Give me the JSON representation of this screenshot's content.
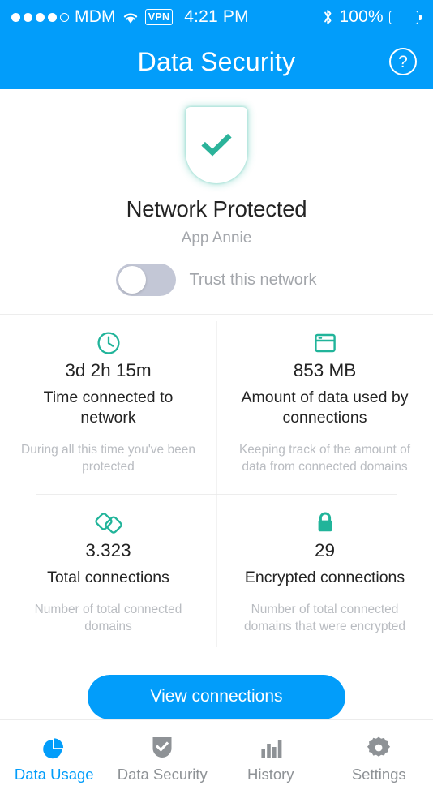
{
  "status_bar": {
    "signal_dots_total": 5,
    "signal_dots_filled": 4,
    "carrier": "MDM",
    "wifi_icon": "wifi-icon",
    "vpn_badge": "VPN",
    "time": "4:21 PM",
    "bluetooth_icon": "bluetooth-icon",
    "battery_percent": "100%",
    "battery_icon": "battery-full-icon"
  },
  "navbar": {
    "title": "Data Security",
    "help_icon": "help-circle-icon",
    "help_label": "?",
    "background_color": "#029dfa"
  },
  "hero": {
    "shield_icon": "shield-check-icon",
    "status_title": "Network Protected",
    "network_name": "App Annie",
    "toggle": {
      "label": "Trust this network",
      "state": "off",
      "track_color": "#c3c7d6"
    }
  },
  "stats": {
    "accent_color": "#21b49a",
    "items": [
      {
        "icon": "clock-icon",
        "value": "3d 2h 15m",
        "label": "Time connected to network",
        "note": "During all this time you've been protected"
      },
      {
        "icon": "browser-window-icon",
        "value": "853 MB",
        "label": "Amount of data used by connections",
        "note": "Keeping track of the amount of data from connected domains"
      },
      {
        "icon": "connections-icon",
        "value": "3.323",
        "label": "Total connections",
        "note": "Number of total connected domains"
      },
      {
        "icon": "lock-icon",
        "value": "29",
        "label": "Encrypted connections",
        "note": "Number of total connected domains that were encrypted"
      }
    ]
  },
  "cta": {
    "label": "View connections",
    "color": "#029dfa"
  },
  "tabbar": {
    "active_color": "#029dfa",
    "inactive_color": "#8e9296",
    "tabs": [
      {
        "icon": "pie-chart-icon",
        "label": "Data Usage",
        "active": true
      },
      {
        "icon": "shield-check-icon",
        "label": "Data Security",
        "active": false
      },
      {
        "icon": "bar-chart-icon",
        "label": "History",
        "active": false
      },
      {
        "icon": "gear-icon",
        "label": "Settings",
        "active": false
      }
    ]
  }
}
